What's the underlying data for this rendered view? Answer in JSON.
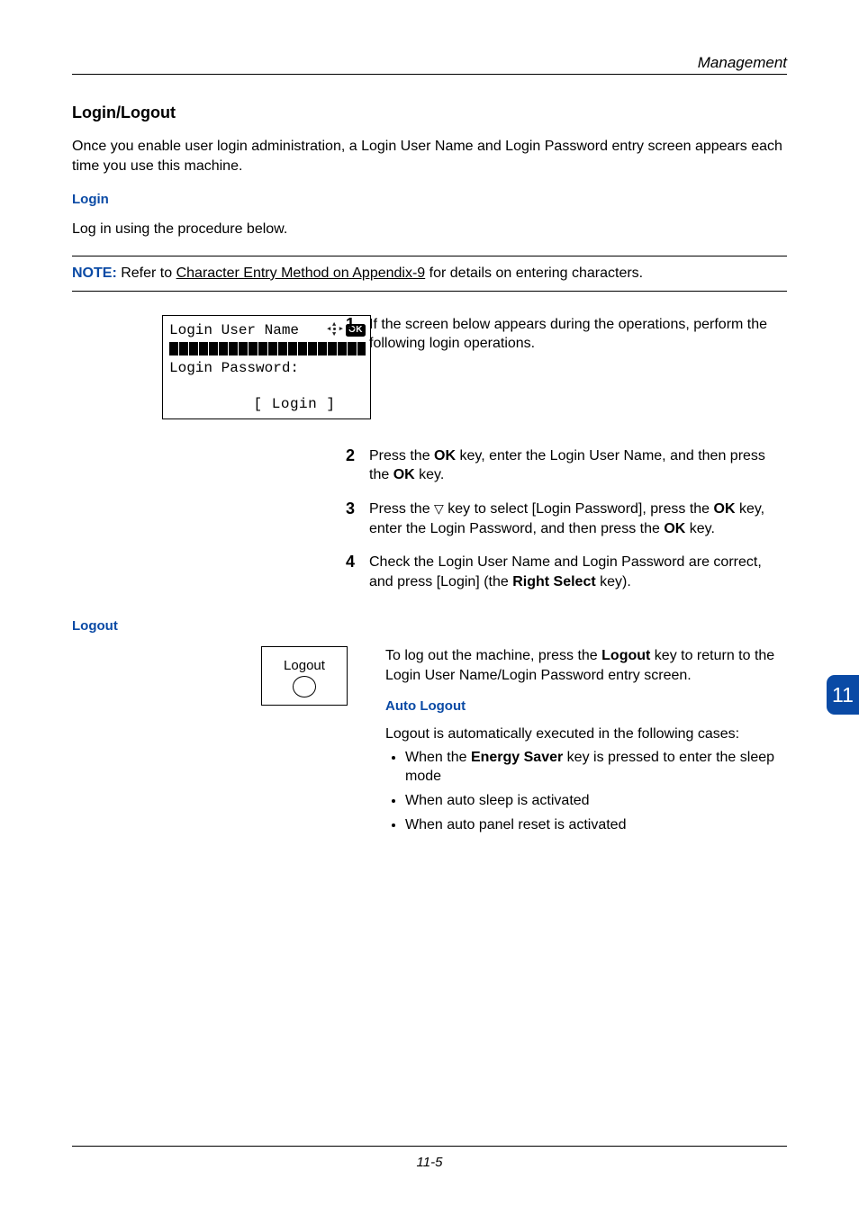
{
  "header": {
    "title": "Management"
  },
  "section": {
    "heading": "Login/Logout",
    "intro": "Once you enable user login administration, a Login User Name and Login Password entry screen appears each time you use this machine."
  },
  "login": {
    "heading": "Login",
    "lead": "Log in using the procedure below.",
    "note": {
      "label": "NOTE:",
      "prefix": " Refer to ",
      "link": "Character Entry Method on Appendix-9",
      "suffix": " for details on entering characters."
    },
    "screen": {
      "line1": "Login User Name",
      "ok": "OK",
      "line2": "Login Password:",
      "softkey": "[ Login  ]"
    },
    "steps": {
      "s1": "If the screen below appears during the operations, perform the following login operations.",
      "s2_a": "Press the ",
      "s2_b": " key, enter the Login User Name, and then press the ",
      "s2_c": " key.",
      "key_ok": "OK",
      "s3_a": "Press the ",
      "s3_tri": "▽",
      "s3_b": " key to select [Login Password], press the ",
      "s3_c": " key, enter the Login Password, and then press the ",
      "s3_d": " key.",
      "s4_a": "Check the Login User Name and Login Password are correct, and press [Login] (the ",
      "s4_key": "Right Select",
      "s4_b": " key)."
    }
  },
  "logout": {
    "heading": "Logout",
    "icon_label": "Logout",
    "text_a": "To log out the machine, press the ",
    "key": "Logout",
    "text_b": " key to return to the Login User Name/Login Password entry screen.",
    "auto_heading": "Auto Logout",
    "auto_lead": "Logout is automatically executed in the following cases:",
    "bullets": {
      "b1_a": "When the ",
      "b1_key": "Energy Saver",
      "b1_b": " key is pressed to enter the sleep mode",
      "b2": "When auto sleep is activated",
      "b3": "When auto panel reset is activated"
    }
  },
  "sidetab": "11",
  "footer": "11-5"
}
